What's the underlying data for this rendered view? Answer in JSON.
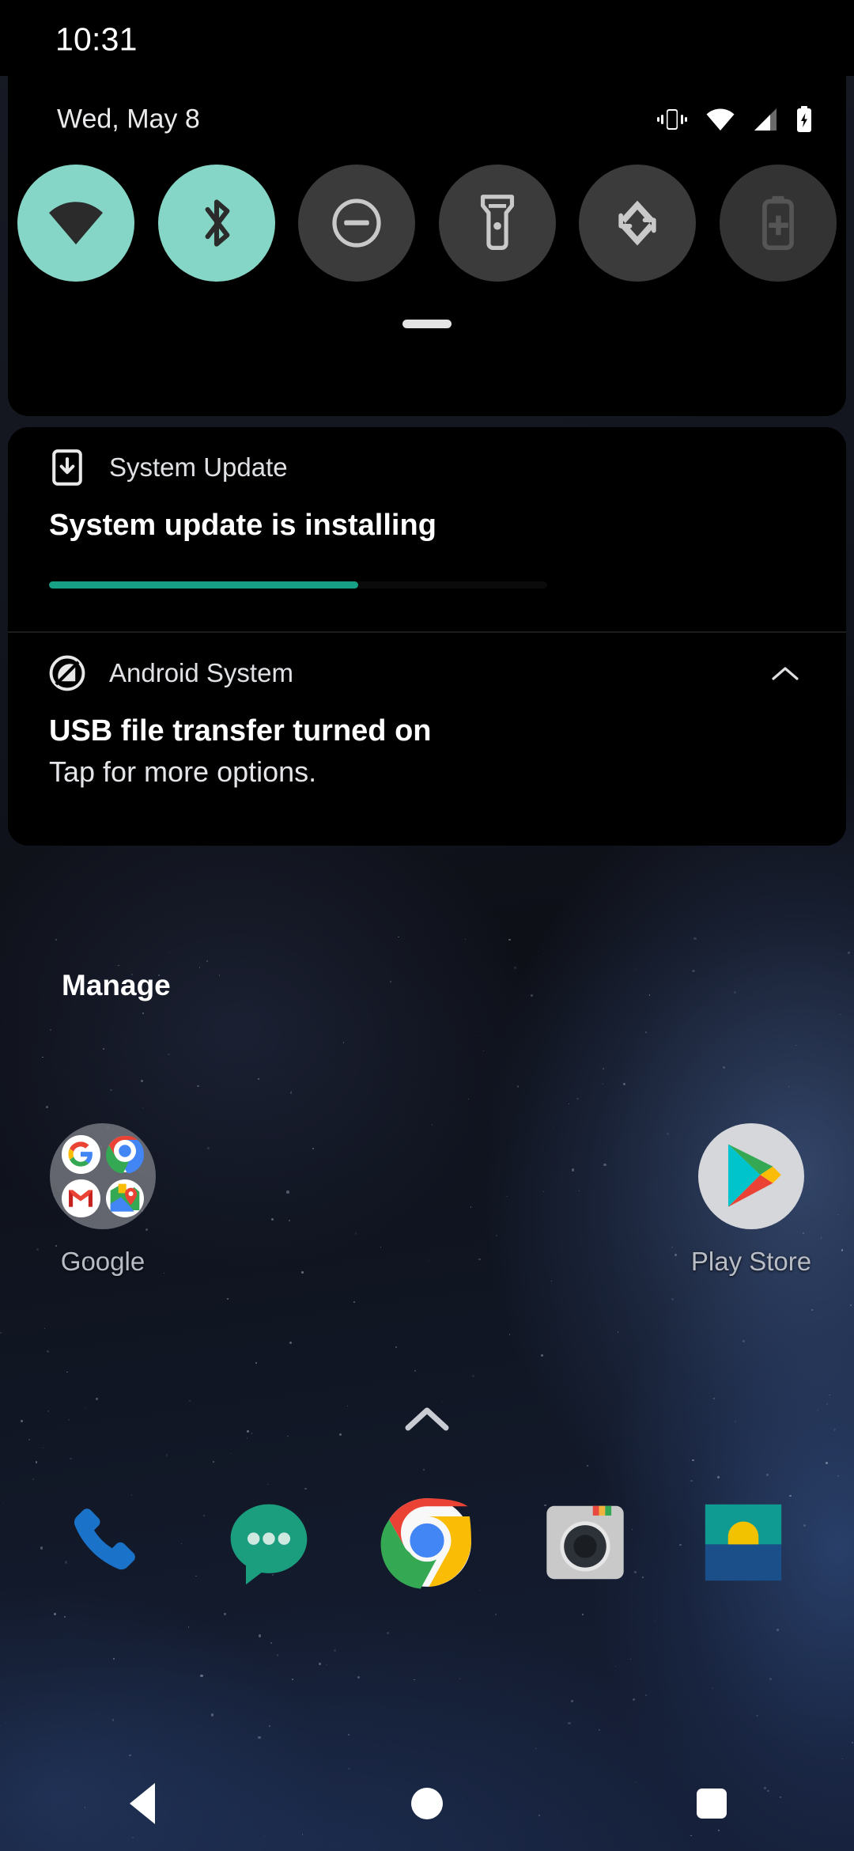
{
  "statusbar": {
    "time": "10:31",
    "icons": [
      "vibrate-icon",
      "wifi-icon",
      "cellular-signal-icon",
      "battery-charging-icon"
    ]
  },
  "quick_settings": {
    "date": "Wed, May 8",
    "active_color": "#85d6c6",
    "inactive_color": "#3b3b3b",
    "handle_label": "drag-handle",
    "tiles": [
      {
        "name": "wifi",
        "icon": "wifi-icon",
        "state": "on"
      },
      {
        "name": "bluetooth",
        "icon": "bluetooth-icon",
        "state": "on"
      },
      {
        "name": "do-not-disturb",
        "icon": "do-not-disturb-icon",
        "state": "off"
      },
      {
        "name": "flashlight",
        "icon": "flashlight-icon",
        "state": "off"
      },
      {
        "name": "auto-rotate",
        "icon": "auto-rotate-icon",
        "state": "off"
      },
      {
        "name": "battery-saver",
        "icon": "battery-saver-icon",
        "state": "disabled"
      }
    ]
  },
  "notifications": [
    {
      "app": "System Update",
      "icon": "system-update-icon",
      "title": "System update is installing",
      "text": "",
      "progress": 62,
      "progress_color": "#16a085",
      "expandable": false
    },
    {
      "app": "Android System",
      "icon": "android-system-icon",
      "title": "USB file transfer turned on",
      "text": "Tap for more options.",
      "expandable": true,
      "expand_icon": "chevron-up-icon"
    }
  ],
  "manage_label": "Manage",
  "home": {
    "apps": [
      {
        "label": "Google",
        "icon": "google-folder-icon"
      },
      {
        "label": "Play Store",
        "icon": "play-store-icon"
      }
    ],
    "drawer_icon": "chevron-up-icon",
    "dock": [
      {
        "label": "Phone",
        "icon": "phone-icon"
      },
      {
        "label": "Messages",
        "icon": "messages-icon"
      },
      {
        "label": "Chrome",
        "icon": "chrome-icon"
      },
      {
        "label": "Camera",
        "icon": "camera-icon"
      },
      {
        "label": "Photos",
        "icon": "photos-icon"
      }
    ]
  },
  "navbar": {
    "back": "back-button",
    "home": "home-button",
    "recents": "recents-button"
  }
}
